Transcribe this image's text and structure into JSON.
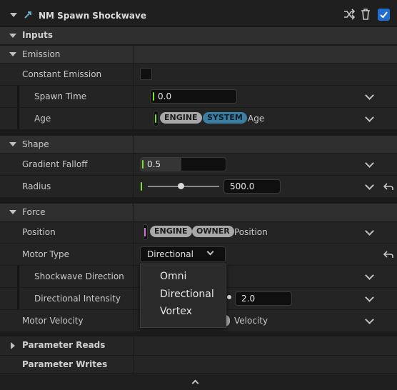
{
  "header": {
    "title": "NM Spawn Shockwave",
    "enabled": true,
    "accent": "#1f6fd1"
  },
  "inputs_label": "Inputs",
  "emission": {
    "label": "Emission",
    "constant_emission": {
      "label": "Constant Emission",
      "checked": false
    },
    "spawn_time": {
      "label": "Spawn Time",
      "value": "0.0"
    },
    "age": {
      "label": "Age",
      "pills": [
        "ENGINE",
        "SYSTEM"
      ],
      "name": "Age"
    }
  },
  "shape": {
    "label": "Shape",
    "gradient_falloff": {
      "label": "Gradient Falloff",
      "value": "0.5",
      "fill_fraction": 0.5
    },
    "radius": {
      "label": "Radius",
      "value": "500.0",
      "slider_fraction": 0.5
    }
  },
  "force": {
    "label": "Force",
    "position": {
      "label": "Position",
      "pills": [
        "ENGINE",
        "OWNER"
      ],
      "name": "Position"
    },
    "motor_type": {
      "label": "Motor Type",
      "selected": "Directional",
      "options": [
        "Omni",
        "Directional",
        "Vortex"
      ]
    },
    "shockwave_direction": {
      "label": "Shockwave Direction"
    },
    "directional_intensity": {
      "label": "Directional Intensity",
      "value": "2.0"
    },
    "motor_velocity": {
      "label": "Motor Velocity",
      "name": "Velocity"
    }
  },
  "parameter_reads": "Parameter Reads",
  "parameter_writes": "Parameter Writes",
  "colors": {
    "green_marker": "#7ee02c",
    "pink_marker": "#d277d9",
    "system_pill": "#3c7fa3",
    "engine_pill": "#a8a8a8"
  }
}
